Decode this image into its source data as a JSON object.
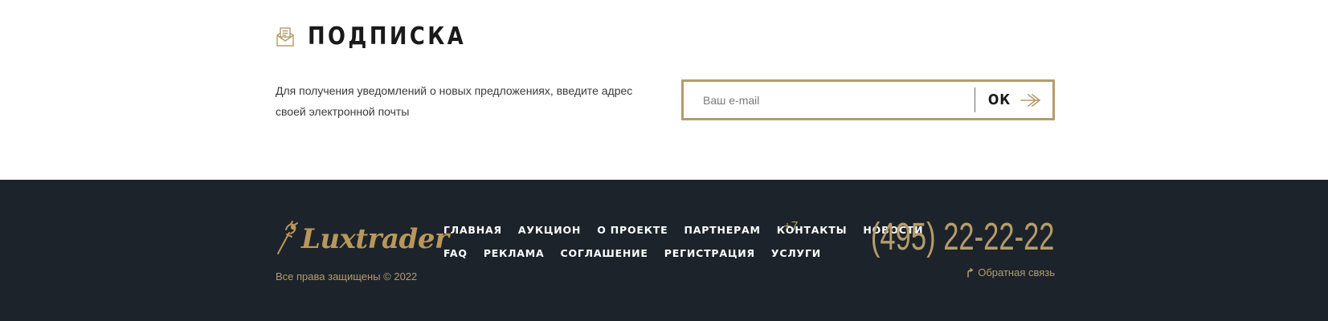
{
  "subscription": {
    "title": "ПОДПИСКА",
    "icon": "envelope-letter-icon",
    "description": "Для получения уведомлений о новых предложениях, введите адрес своей электронной почты",
    "email_placeholder": "Ваш e-mail",
    "email_value": "",
    "submit_label": "ОК",
    "submit_icon": "arrow-right-icon"
  },
  "footer": {
    "logo_text": "Luxtrader",
    "logo_icon": "gavel-logo-icon",
    "copyright": "Все права защищены © 2022",
    "nav_row_1": [
      "ГЛАВНАЯ",
      "АУКЦИОН",
      "О ПРОЕКТЕ",
      "ПАРТНЕРАМ",
      "КОНТАКТЫ",
      "НОВОСТИ"
    ],
    "nav_row_2": [
      "FAQ",
      "РЕКЛАМА",
      "СОГЛАШЕНИЕ",
      "РЕГИСТРАЦИЯ",
      "УСЛУГИ"
    ],
    "phone_prefix": "+7",
    "phone_number": "(495) 22-22-22",
    "feedback_label": "Обратная связь",
    "feedback_icon": "callback-arrow-icon"
  },
  "colors": {
    "accent_gold": "#b59c6a",
    "footer_bg": "#1c232a",
    "text_dark": "#1a1a1a"
  }
}
